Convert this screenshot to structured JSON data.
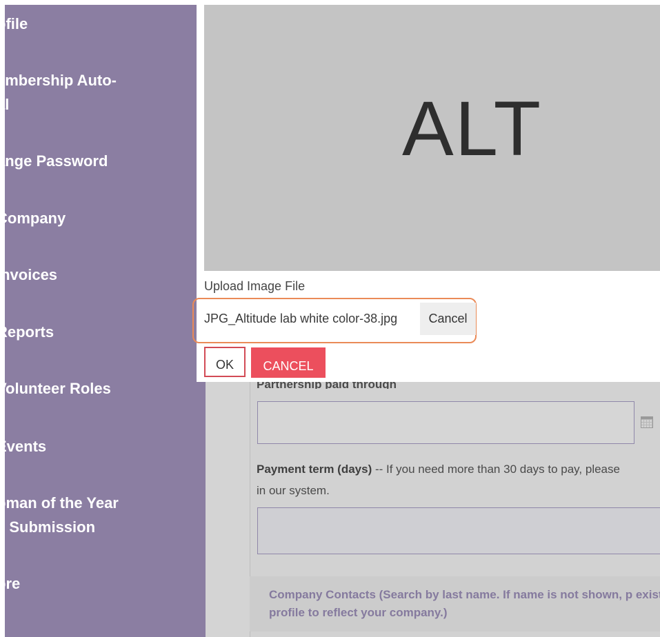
{
  "sidebar": {
    "items": [
      {
        "label": "ofile"
      },
      {
        "label": "embership Auto-\nal"
      },
      {
        "label": "ange Password"
      },
      {
        "label": " Company"
      },
      {
        "label": " Invoices"
      },
      {
        "label": " Reports"
      },
      {
        "label": " Volunteer Roles"
      },
      {
        "label": " Events"
      },
      {
        "label": "oman of the Year\ns Submission"
      },
      {
        "label": "ore"
      }
    ]
  },
  "form": {
    "partnership_label": "Partnership paid through",
    "payment_term_bold": "Payment term (days)",
    "payment_term_rest": " -- If you need more than 30 days to pay, please",
    "payment_term_line2": "in our system.",
    "contacts_text": "Company Contacts (Search by last name. If name is not shown, p existing profile to reflect your company.)"
  },
  "dialog": {
    "preview_text": "ALT",
    "upload_label": "Upload Image File",
    "file_name": "JPG_Altitude lab white color-38.jpg",
    "file_cancel_label": "Cancel",
    "ok_label": "OK",
    "cancel_label": "CANCEL"
  },
  "colors": {
    "sidebar_bg": "#8b7ea2",
    "highlight_orange": "#ea8a57",
    "cancel_red": "#ec4f5d"
  },
  "icons": {
    "calendar": "calendar-icon"
  }
}
